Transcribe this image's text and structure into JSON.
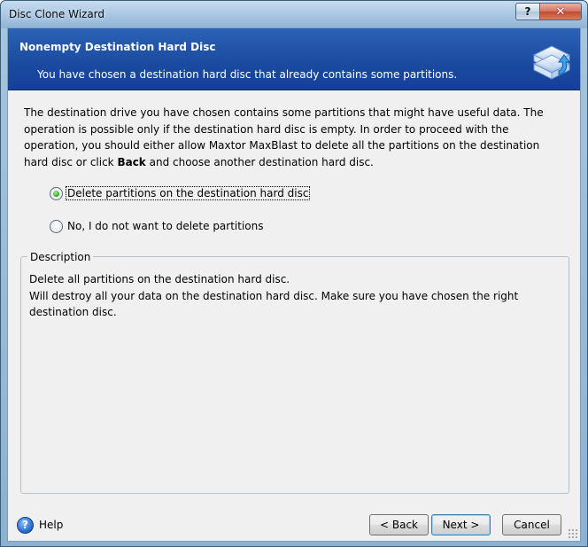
{
  "window": {
    "title": "Disc Clone Wizard",
    "help_glyph": "?",
    "close_glyph": "✕"
  },
  "header": {
    "title": "Nonempty Destination Hard Disc",
    "subtitle": "You have chosen a destination hard disc that already contains some partitions.",
    "icon": "disc-clone-icon"
  },
  "intro": {
    "text_before": "The destination drive you have chosen contains some partitions that might have useful data. The operation is possible only if the destination hard disc is empty. In order to proceed with the operation, you should either allow Maxtor MaxBlast to delete all the partitions on the destination hard disc or click ",
    "bold_word": "Back",
    "text_after": " and choose another destination hard disc."
  },
  "options": [
    {
      "label": "Delete partitions on the destination hard disc",
      "checked": true,
      "mnemonic": "D"
    },
    {
      "label": "No, I do not want to delete partitions",
      "checked": false,
      "mnemonic": "w"
    }
  ],
  "description": {
    "legend": "Description",
    "line1": "Delete all partitions on the destination hard disc.",
    "line2": "Will destroy all your data on the destination hard disc. Make sure you have chosen the right destination disc."
  },
  "footer": {
    "help_label": "Help",
    "back_label": "< Back",
    "next_label": "Next >",
    "cancel_label": "Cancel"
  },
  "colors": {
    "header_bg": "#1f55ad",
    "radio_selected": "#23a616",
    "default_button_border": "#3c7fb1"
  }
}
